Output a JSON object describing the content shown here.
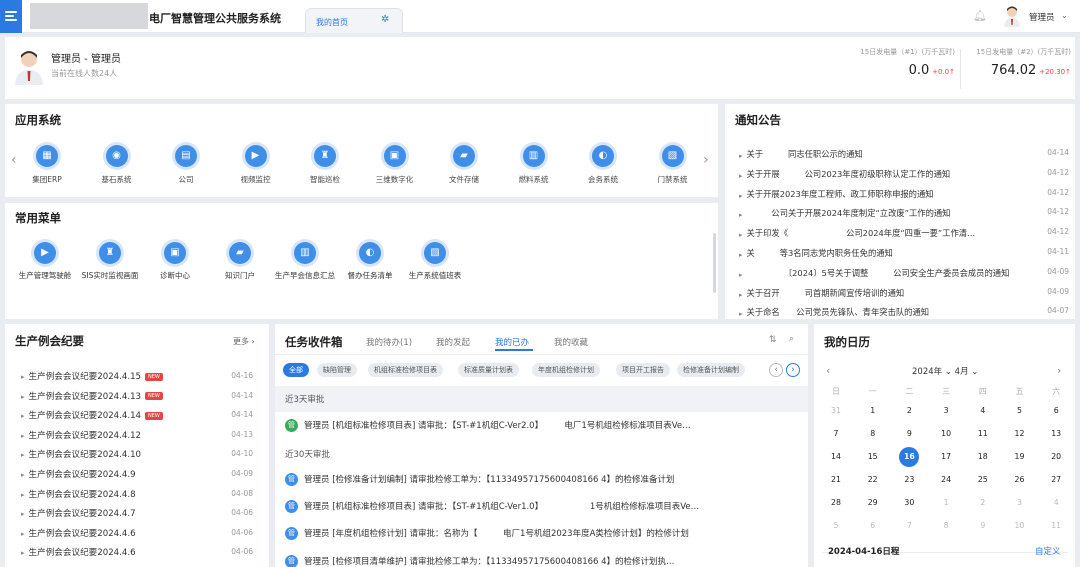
{
  "header": {
    "system_title": "电厂智慧管理公共服务系统",
    "tab_label": "我的首页",
    "user_name": "管理员"
  },
  "profile": {
    "name": "管理员 - 管理员",
    "online": "当前在线人数24人",
    "stats": [
      {
        "label": "15日发电量（#1）(万千瓦时)",
        "value": "0.0",
        "delta": "+0.0"
      },
      {
        "label": "15日发电量（#2）(万千瓦时)",
        "value": "764.02",
        "delta": "+20.30"
      }
    ]
  },
  "apps": {
    "title": "应用系统",
    "items": [
      {
        "label": "集团ERP",
        "icon": "erp-icon"
      },
      {
        "label": "基石系统",
        "icon": "base-icon"
      },
      {
        "label": "公司",
        "icon": "company-icon"
      },
      {
        "label": "视频监控",
        "icon": "video-icon"
      },
      {
        "label": "智能巡检",
        "icon": "inspection-icon"
      },
      {
        "label": "三维数字化",
        "icon": "3d-icon"
      },
      {
        "label": "文件存储",
        "icon": "folder-icon"
      },
      {
        "label": "燃料系统",
        "icon": "fuel-icon"
      },
      {
        "label": "会务系统",
        "icon": "meeting-icon"
      },
      {
        "label": "门禁系统",
        "icon": "access-icon"
      }
    ]
  },
  "menus": {
    "title": "常用菜单",
    "items": [
      {
        "label": "生产管理驾驶舱"
      },
      {
        "label": "SIS实时监视画面"
      },
      {
        "label": "诊断中心"
      },
      {
        "label": "知识门户"
      },
      {
        "label": "生产早会信息汇总"
      },
      {
        "label": "督办任务清单"
      },
      {
        "label": "生产系统值班表"
      }
    ]
  },
  "notice": {
    "title": "通知公告",
    "items": [
      {
        "text": "关于　　　同志任职公示的通知",
        "date": "04-14"
      },
      {
        "text": "关于开展　　　公司2023年度初级职称认定工作的通知",
        "date": "04-12"
      },
      {
        "text": "关于开展2023年度工程师、政工师职称申报的通知",
        "date": "04-12"
      },
      {
        "text": "　　　公司关于开展2024年度制定“立改废”工作的通知",
        "date": "04-12"
      },
      {
        "text": "关于印发《　　　　　　　公司2024年度“四重一要”工作清…",
        "date": "04-12"
      },
      {
        "text": "关　　　等3名同志党内职务任免的通知",
        "date": "04-11"
      },
      {
        "text": "　　　　　〔2024〕5号关于调整　　　公司安全生产委员会成员的通知",
        "date": "04-09"
      },
      {
        "text": "关于召开　　　司首期新闻宣传培训的通知",
        "date": "04-09"
      },
      {
        "text": "关于命名　　公司党员先锋队、青年突击队的通知",
        "date": "04-07"
      }
    ]
  },
  "meetings": {
    "title": "生产例会纪要",
    "more": "更多",
    "new_badge": "NEW",
    "items": [
      {
        "text": "生产例会会议纪要2024.4.15",
        "date": "04-16",
        "new": true
      },
      {
        "text": "生产例会会议纪要2024.4.13",
        "date": "04-14",
        "new": true
      },
      {
        "text": "生产例会会议纪要2024.4.14",
        "date": "04-14",
        "new": true
      },
      {
        "text": "生产例会会议纪要2024.4.12",
        "date": "04-13",
        "new": false
      },
      {
        "text": "生产例会会议纪要2024.4.10",
        "date": "04-10",
        "new": false
      },
      {
        "text": "生产例会会议纪要2024.4.9",
        "date": "04-09",
        "new": false
      },
      {
        "text": "生产例会会议纪要2024.4.8",
        "date": "04-08",
        "new": false
      },
      {
        "text": "生产例会会议纪要2024.4.7",
        "date": "04-06",
        "new": false
      },
      {
        "text": "生产例会会议纪要2024.4.6",
        "date": "04-06",
        "new": false
      },
      {
        "text": "生产例会会议纪要2024.4.6",
        "date": "04-06",
        "new": false
      }
    ]
  },
  "tasks": {
    "title": "任务收件箱",
    "tabs": [
      "我的待办(1)",
      "我的发起",
      "我的已办",
      "我的收藏"
    ],
    "active_tab": 2,
    "chips": [
      "全部",
      "缺陷管理",
      "机组标准检修项目表",
      "标准质量计划表",
      "年度机组检修计划",
      "项目开工报告",
      "检修准备计划编制"
    ],
    "section_recent": "近3天审批",
    "section_month": "近30天审批",
    "rows": [
      {
        "avatar": "管",
        "text": "管理员 [机组标准检修项目表] 请审批：【ST-#1机组C-Ver2.0】　　　电厂1号机组检修标准项目表Ve…"
      },
      {
        "avatar": "管",
        "text": "管理员 [检修准备计划编制] 请审批检修工单为：【11334957175600408166 4】的检修准备计划"
      },
      {
        "avatar": "管",
        "text": "管理员 [机组标准检修项目表] 请审批：【ST-#1机组C-Ver1.0】　　　　　　1号机组检修标准项目表Ve…"
      },
      {
        "avatar": "管",
        "text": "管理员 [年度机组检修计划] 请审批：名称为【　　　电厂1号机组2023年度A类检修计划】的检修计划"
      },
      {
        "avatar": "管",
        "text": "管理员 [检修项目清单维护] 请审批检修工单为：【11334957175600408166 4】的检修计划执…"
      }
    ]
  },
  "calendar": {
    "title": "我的日历",
    "year": "2024年",
    "month": "4月",
    "weekdays": [
      "日",
      "一",
      "二",
      "三",
      "四",
      "五",
      "六"
    ],
    "weeks": [
      [
        "31",
        "1",
        "2",
        "3",
        "4",
        "5",
        "6"
      ],
      [
        "7",
        "8",
        "9",
        "10",
        "11",
        "12",
        "13"
      ],
      [
        "14",
        "15",
        "16",
        "17",
        "18",
        "19",
        "20"
      ],
      [
        "21",
        "22",
        "23",
        "24",
        "25",
        "26",
        "27"
      ],
      [
        "28",
        "29",
        "30",
        "1",
        "2",
        "3",
        "4"
      ],
      [
        "5",
        "6",
        "7",
        "8",
        "9",
        "10",
        "11"
      ]
    ],
    "today": "16",
    "schedule_label": "2024-04-16日程",
    "custom_label": "自定义"
  },
  "colors": {
    "accent": "#2a7ae2",
    "up": "#e6434a",
    "badge": "#e64545"
  }
}
